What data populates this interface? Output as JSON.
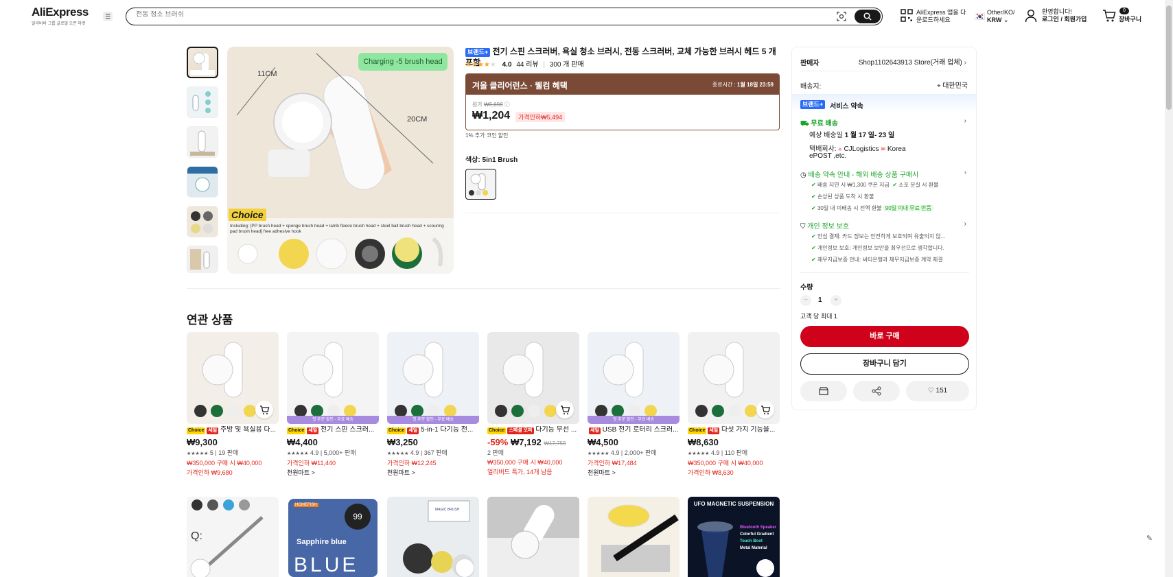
{
  "header": {
    "logo": "AliExpress",
    "logo_sub": "알리바바 그룹 글로벌 오픈 마켓",
    "search_placeholder": "전동 청소 브러쉬",
    "app_line1": "AliExpress 앱을 다",
    "app_line2": "운로드하세요",
    "region_line1": "Other/KO/",
    "region_line2": "KRW",
    "welcome": "환영합니다!",
    "login": "로그인 / 회원가입",
    "cart_count": "0",
    "cart_label": "장바구니"
  },
  "product": {
    "brand_badge": "브랜드+",
    "title": "전기 스핀 스크러버, 욕실 청소 브러시, 전동 스크러버, 교체 가능한 브러시 헤드 5 개 포함",
    "rating": "4.0",
    "reviews": "44 리뷰",
    "sold": "300 개 판매",
    "main_image_badge": "Charging -5 brush head",
    "dim1": "11CM",
    "dim2": "20CM",
    "choice_label": "Choice",
    "included_text": "Including: [PP brush head + sponge brush head + lamb fleece brush head + steel ball brush head + scouring pad brush head] free adhesive hook",
    "promo_title": "겨울 클리어런스 · 웰컴 혜택",
    "promo_end_label": "종료시간 :",
    "promo_end": "1월 18일 23:59",
    "orig_label": "원가",
    "orig_price": "₩6,698",
    "price": "₩1,204",
    "discount": "가격인하₩5,494",
    "coin_note": "1% 추가 코인 할인",
    "color_label": "색상:",
    "color_value": "5in1 Brush"
  },
  "panel": {
    "seller_label": "판매자",
    "seller": "Shop1102643913 Store(거래 업체)",
    "ship_to_label": "배송지:",
    "ship_to": "대한민국",
    "service_badge": "브랜드+",
    "service_title": "서비스 약속",
    "free_ship": "무료 배송",
    "est_label": "예상 배송일",
    "est_date": "1 월 17 일- 23 일",
    "courier_label": "택배회사:",
    "courier1": "CJLogistics",
    "courier2": "Korea",
    "courier3": "ePOST ,etc.",
    "delivery_promise": "배송 약속 안내 - 해외 배송 상품 구매시",
    "dp1": "배송 지연 시 ₩1,300 쿠폰 지급",
    "dp2": "소포 분실 시 환불",
    "dp3": "손상된 상품 도착 시 환불",
    "dp4": "30일 내 미배송 시 전액 환불",
    "dp4_badge": "90일 이내 무료 반품",
    "privacy": "개인 정보 보호",
    "pv1": "안심 결제: 카드 정보는 안전하게 보호되며 유출되지 않...",
    "pv2": "개인정보 보호: 개인정보 보안을 최우선으로 생각합니다.",
    "pv3": "채무지급보증 안내: 씨티은행과 채무지급보증 계약 체결",
    "qty_label": "수량",
    "qty_minus": "−",
    "qty": "1",
    "qty_plus": "+",
    "max_per": "고객 당 최대 1",
    "buy_now": "바로 구매",
    "add_cart": "장바구니 담기",
    "wish_count": "151"
  },
  "related": {
    "title": "연관 상품",
    "choice": "Choice",
    "items": [
      {
        "tag2": "세일",
        "name": "주방 및 욕실용 다...",
        "price": "₩9,300",
        "rating_line": "5 | 19 판매",
        "line1": "₩350,000 구매 시 ₩40,000",
        "line2": "가격인하 ₩9,680",
        "line3": "",
        "strip": ""
      },
      {
        "tag2": "세일",
        "name": "전기 스핀 스크러...",
        "price": "₩4,400",
        "rating_line": "4.9 | 5,000+ 판매",
        "line1": "가격인하 ₩11,440",
        "line2": "천원마트 >",
        "line3": "",
        "strip": "첫 주문 할인 · 무료 배송"
      },
      {
        "tag2": "세일",
        "name": "5-in-1 다기능 전...",
        "price": "₩3,250",
        "rating_line": "4.9 | 367 판매",
        "line1": "가격인하 ₩12,245",
        "line2": "천원마트 >",
        "line3": "",
        "strip": "첫 주문 할인 · 무료 배송"
      },
      {
        "tag2": "스페셜 오퍼",
        "name": "다기능 무선 ...",
        "price": "₩7,192",
        "discount": "-59%",
        "old_price": "₩17,759",
        "rating_line": "2 판매",
        "line1": "₩350,000 구매 시 ₩40,000",
        "line2": "얼리버드 특가, 14개 남음",
        "line3": "",
        "strip": ""
      },
      {
        "tag2": "세일",
        "name": "USB 전기 로터리 스크러...",
        "price": "₩4,500",
        "rating_line": "4.9 | 2,000+ 판매",
        "line1": "가격인하 ₩17,484",
        "line2": "천원마트 >",
        "line3": "",
        "strip": "첫 주문 할인 · 무료 배송"
      },
      {
        "tag2": "세일",
        "name": "다섯 가지 기능을...",
        "price": "₩8,630",
        "rating_line": "4.9 | 110 판매",
        "line1": "₩350,000 구매 시 ₩40,000",
        "line2": "가격인하 ₩8,630",
        "line3": "",
        "strip": ""
      }
    ],
    "row2_text1": "Sapphire blue",
    "row2_text2": "BLUE",
    "row2_text3": "UFO MAGNETIC SUSPENSION",
    "row2_text4": "Bluetooth Speaker",
    "row2_text5": "Colorful Gradient",
    "row2_text6": "Touch Boot",
    "row2_text7": "Metal Material",
    "row2_brand": "HOMEFISH",
    "row2_num": "99",
    "row2_magic": "MAGIC BRUSH"
  }
}
